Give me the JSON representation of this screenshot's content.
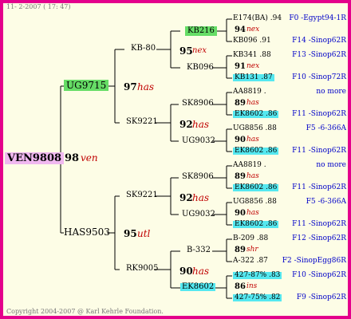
{
  "header": {
    "date": "11- 2-2007 ( 17: 47)"
  },
  "footer": {
    "copyright": "Copyright 2004-2007 @ Karl Kehrle Foundation."
  },
  "colors": {
    "border": "#e4008c",
    "background": "#fdfde6",
    "name_red": "#c00000",
    "ref_blue": "#0000c8",
    "highlight_cyan": "#55e8f0",
    "highlight_green": "#66dd66",
    "highlight_pink": "#f0b8f0"
  },
  "gen0": {
    "name": "VEN9808"
  },
  "gen1": {
    "root": {
      "num": "98",
      "tag": "ven"
    },
    "upper": {
      "name": "UG9715"
    },
    "lower": {
      "name": "HAS9503"
    }
  },
  "gen2": {
    "upper": {
      "num": "97",
      "tag": "has",
      "upper": "KB-80",
      "lower": "SK9221"
    },
    "lower": {
      "num": "95",
      "tag": "utl",
      "upper": "SK9221",
      "lower": "RK9005"
    }
  },
  "gen3": {
    "a": {
      "num": "95",
      "tag": "nex",
      "upper": "KB216",
      "lower": "KB096"
    },
    "b": {
      "num": "92",
      "tag": "has",
      "upper": "SK8906",
      "lower": "UG9032"
    },
    "c": {
      "num": "92",
      "tag": "has",
      "upper": "SK8906",
      "lower": "UG9032"
    },
    "d": {
      "num": "90",
      "tag": "has",
      "upper": "B-332",
      "lower": "EK8602"
    }
  },
  "gen4": [
    {
      "top": "E174(BA) .94",
      "num": "94",
      "tag": "nex",
      "bottom": "KB096 .91",
      "top_ref": "F0 -Egypt94-1R",
      "bottom_ref": "F14 -Sinop62R"
    },
    {
      "top": "KB341 .88",
      "num": "91",
      "tag": "nex",
      "bottom": "KB131 .87",
      "top_ref": "F13 -Sinop62R",
      "bottom_ref": "F10 -Sinop72R"
    },
    {
      "top": "AA8819 .",
      "num": "89",
      "tag": "has",
      "bottom": "EK8602 .86",
      "top_ref": "no more",
      "bottom_ref": "F11 -Sinop62R"
    },
    {
      "top": "UG8856 .88",
      "num": "90",
      "tag": "has",
      "bottom": "EK8602 .86",
      "top_ref": "F5 -6-366A",
      "bottom_ref": "F11 -Sinop62R"
    },
    {
      "top": "AA8819 .",
      "num": "89",
      "tag": "has",
      "bottom": "EK8602 .86",
      "top_ref": "no more",
      "bottom_ref": "F11 -Sinop62R"
    },
    {
      "top": "UG8856 .88",
      "num": "90",
      "tag": "has",
      "bottom": "EK8602 .86",
      "top_ref": "F5 -6-366A",
      "bottom_ref": "F11 -Sinop62R"
    },
    {
      "top": "B-209 .88",
      "num": "89",
      "tag": "shr",
      "bottom": "A-322 .87",
      "top_ref": "F12 -Sinop62R",
      "bottom_ref": "F2 -SinopEgg86R"
    },
    {
      "top": "427-87% .83",
      "num": "86",
      "tag": "ins",
      "bottom": "427-75% .82",
      "top_ref": "F10 -Sinop62R",
      "bottom_ref": "F9 -Sinop62R"
    }
  ]
}
